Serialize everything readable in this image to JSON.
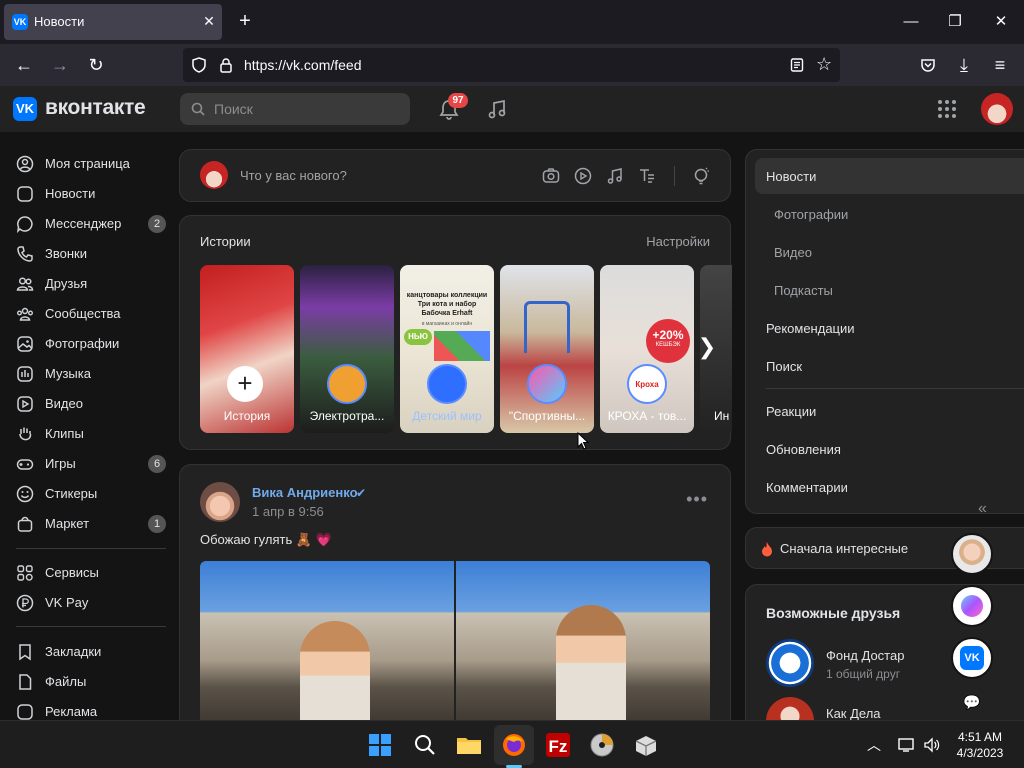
{
  "browser": {
    "tab_title": "Новости",
    "url": "https://vk.com/feed",
    "favicon": "VK"
  },
  "header": {
    "logo_text": "вконтакте",
    "logo_mark": "VK",
    "search_placeholder": "Поиск",
    "notifications_count": "97"
  },
  "sidebar": {
    "items": [
      {
        "label": "Моя страница",
        "icon": "user-circle-icon"
      },
      {
        "label": "Новости",
        "icon": "news-icon"
      },
      {
        "label": "Мессенджер",
        "icon": "chat-icon",
        "count": "2"
      },
      {
        "label": "Звонки",
        "icon": "phone-icon"
      },
      {
        "label": "Друзья",
        "icon": "friends-icon"
      },
      {
        "label": "Сообщества",
        "icon": "communities-icon"
      },
      {
        "label": "Фотографии",
        "icon": "photo-icon"
      },
      {
        "label": "Музыка",
        "icon": "music-icon"
      },
      {
        "label": "Видео",
        "icon": "video-icon"
      },
      {
        "label": "Клипы",
        "icon": "clips-icon"
      },
      {
        "label": "Игры",
        "icon": "gamepad-icon",
        "count": "6"
      },
      {
        "label": "Стикеры",
        "icon": "smile-icon"
      },
      {
        "label": "Маркет",
        "icon": "bag-icon",
        "count": "1"
      }
    ],
    "services": [
      {
        "label": "Сервисы",
        "icon": "services-icon"
      },
      {
        "label": "VK Pay",
        "icon": "ruble-icon"
      }
    ],
    "extra": [
      {
        "label": "Закладки",
        "icon": "bookmark-icon"
      },
      {
        "label": "Файлы",
        "icon": "file-icon"
      },
      {
        "label": "Реклама",
        "icon": "ads-icon"
      }
    ]
  },
  "compose": {
    "placeholder": "Что у вас нового?"
  },
  "stories": {
    "title": "Истории",
    "settings": "Настройки",
    "items": [
      {
        "caption": "История"
      },
      {
        "caption": "Электротра..."
      },
      {
        "caption": "Детский мир"
      },
      {
        "caption": "\"Спортивны..."
      },
      {
        "caption": "КРОХА - тов..."
      },
      {
        "caption": "Ин"
      }
    ],
    "story3_text": "канцтовары коллекции Три кота и набор Бабочка Erhaft",
    "story3_sub": "в магазинах и онлайн",
    "story3_badge": "НЬЮ",
    "story5_badge": "+20%",
    "story5_badge2": "КЕШБЭК",
    "story5_logo": "Кроха"
  },
  "post": {
    "author": "Вика Андриенко",
    "date": "1 апр в 9:56",
    "text": "Обожаю гулять 🧸 💗"
  },
  "right_menu": {
    "items": [
      {
        "label": "Новости",
        "active": true
      },
      {
        "label": "Фотографии",
        "sub": true
      },
      {
        "label": "Видео",
        "sub": true
      },
      {
        "label": "Подкасты",
        "sub": true
      },
      {
        "label": "Рекомендации"
      },
      {
        "label": "Поиск"
      },
      {
        "label": "Реакции"
      },
      {
        "label": "Обновления"
      },
      {
        "label": "Комментарии"
      }
    ]
  },
  "sort": {
    "label": "Сначала интересные"
  },
  "friends": {
    "title": "Возможные друзья",
    "items": [
      {
        "name": "Фонд Достар",
        "sub": "1 общий друг"
      },
      {
        "name": "Как Дела",
        "sub": ""
      }
    ]
  },
  "taskbar": {
    "time": "4:51 AM",
    "date": "4/3/2023"
  },
  "colors": {
    "accent": "#0077ff",
    "link": "#71aaeb",
    "badge": "#e64646",
    "bg": "#141414",
    "card": "#222222"
  }
}
